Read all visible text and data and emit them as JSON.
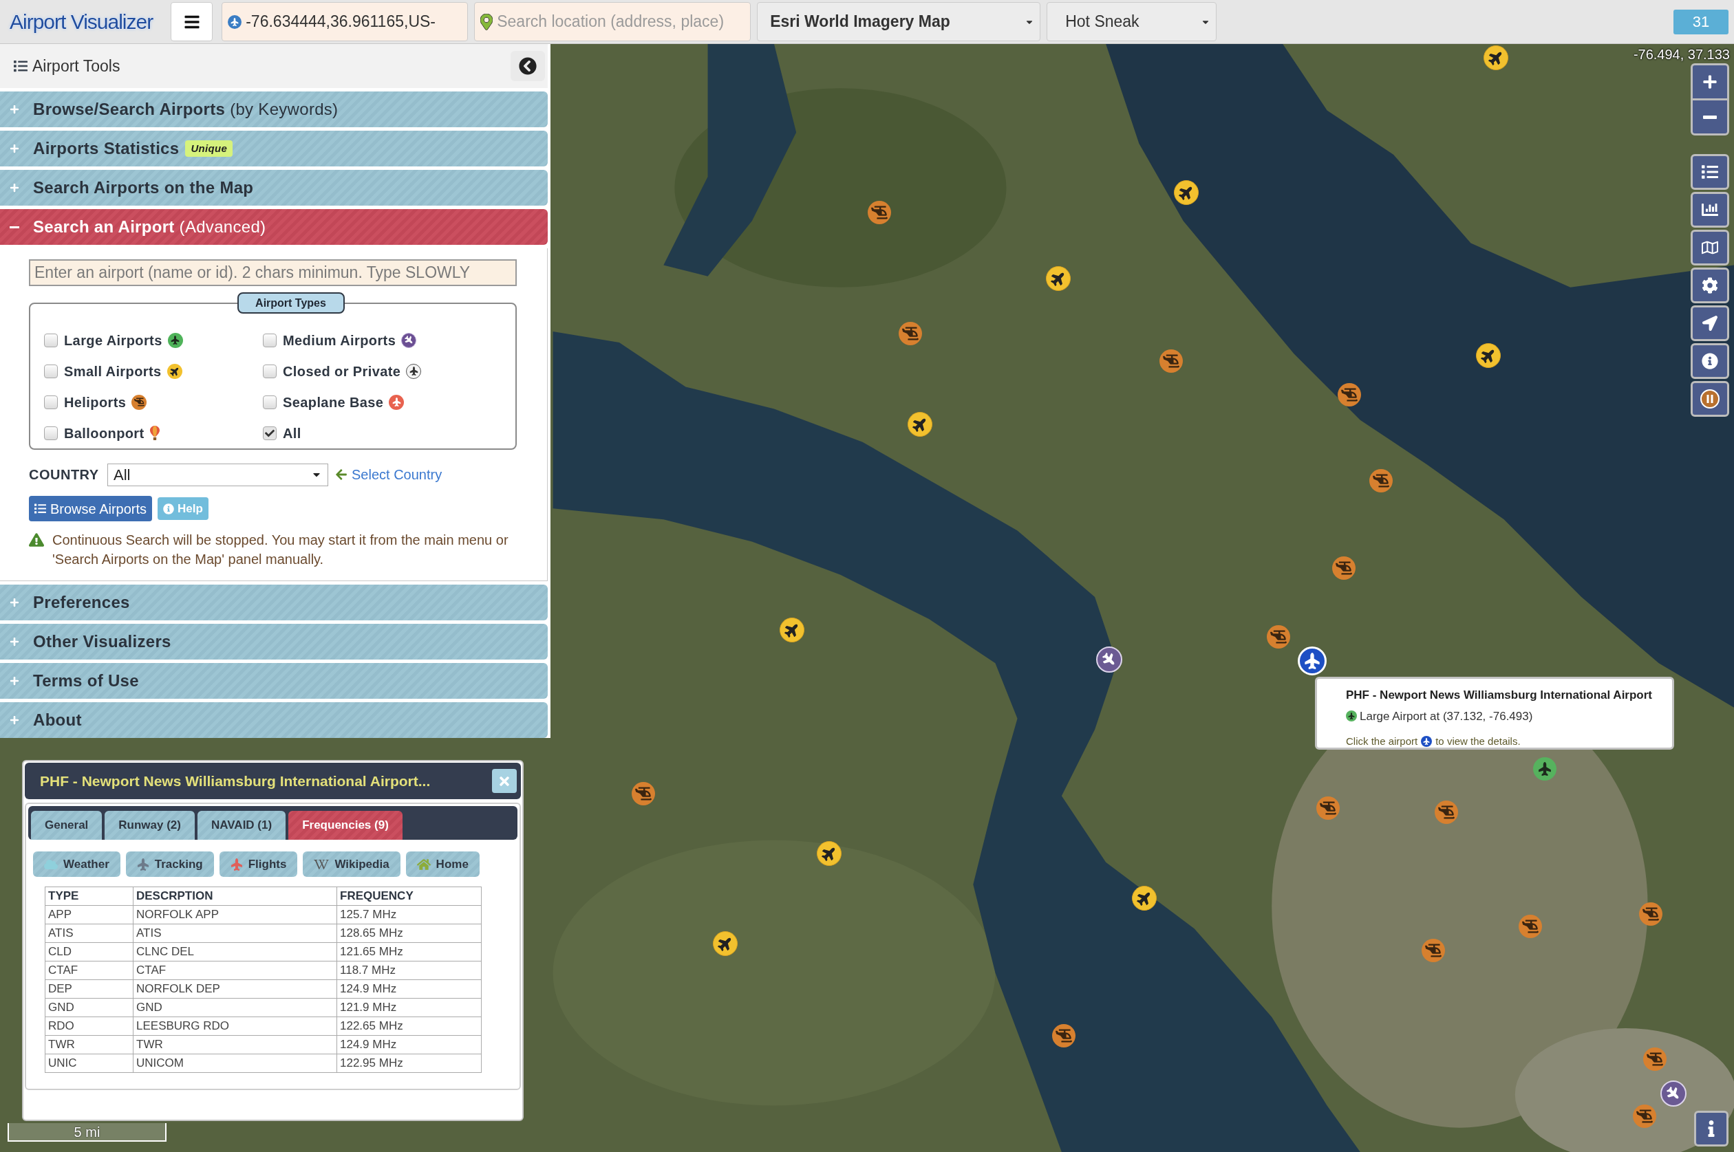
{
  "app_bar": {
    "logo": "Airport Visualizer",
    "coordinates_field": {
      "value": "-76.634444,36.961165,US-"
    },
    "location_search": {
      "placeholder": "Search location (address, place)"
    },
    "basemap_select": {
      "value": "Esri World Imagery Map"
    },
    "theme_select": {
      "value": "Hot Sneak"
    },
    "count_badge": "31"
  },
  "sidebar": {
    "title": "Airport Tools",
    "sections": [
      {
        "title": "Browse/Search Airports",
        "note": "(by Keywords)",
        "expanded": false
      },
      {
        "title": "Airports Statistics",
        "badge": "Unique",
        "expanded": false
      },
      {
        "title": "Search Airports on the Map",
        "expanded": false
      },
      {
        "title": "Search an Airport",
        "note": "(Advanced)",
        "expanded": true
      },
      {
        "title": "Preferences",
        "expanded": false
      },
      {
        "title": "Other Visualizers",
        "expanded": false
      },
      {
        "title": "Terms of Use",
        "expanded": false
      },
      {
        "title": "About",
        "expanded": false
      }
    ]
  },
  "search_panel": {
    "airport_field": {
      "placeholder": "Enter an airport (name or id). 2 chars minimun. Type SLOWLY"
    },
    "types_legend": "Airport Types",
    "airport_types": [
      {
        "label": "Large Airports",
        "kind": "large",
        "checked": false
      },
      {
        "label": "Medium Airports",
        "kind": "medium",
        "checked": false
      },
      {
        "label": "Small Airports",
        "kind": "small",
        "checked": false
      },
      {
        "label": "Closed or Private",
        "kind": "closed",
        "checked": false
      },
      {
        "label": "Heliports",
        "kind": "heliport",
        "checked": false
      },
      {
        "label": "Seaplane Base",
        "kind": "seaplane",
        "checked": false
      },
      {
        "label": "Balloonport",
        "kind": "balloon",
        "checked": false
      },
      {
        "label": "All",
        "kind": "all",
        "checked": true
      }
    ],
    "country": {
      "label": "COUNTRY",
      "value": "All",
      "link": "Select Country"
    },
    "buttons": [
      {
        "label": "Browse Airports",
        "kind": "browse"
      },
      {
        "label": "Help",
        "kind": "help"
      }
    ],
    "warning": "Continuous Search will be stopped. You may start it from the main menu or 'Search Airports on the Map' panel manually."
  },
  "map": {
    "coordinates": "-76.494, 37.133",
    "scale": "5 mi",
    "tooltip": {
      "title": "PHF - Newport News Williamsburg International Airport",
      "detail": "Large Airport at (37.132, -76.493)",
      "hint_start": "Click the airport",
      "hint_end": "to view the details."
    }
  },
  "airport_popup": {
    "title": "PHF - Newport News Williamsburg International Airport...",
    "tabs": [
      {
        "label": "General",
        "selected": false
      },
      {
        "label": "Runway (2)",
        "selected": false
      },
      {
        "label": "NAVAID (1)",
        "selected": false
      },
      {
        "label": "Frequencies (9)",
        "selected": true
      }
    ],
    "links": [
      {
        "label": "Weather",
        "kind": "weather"
      },
      {
        "label": "Tracking",
        "kind": "tracking"
      },
      {
        "label": "Flights",
        "kind": "flights"
      },
      {
        "label": "Wikipedia",
        "kind": "wikipedia"
      },
      {
        "label": "Home",
        "kind": "home"
      }
    ],
    "table": {
      "columns": [
        "TYPE",
        "DESCRPTION",
        "FREQUENCY"
      ],
      "rows": [
        [
          "APP",
          "NORFOLK APP",
          "125.7 MHz"
        ],
        [
          "ATIS",
          "ATIS",
          "128.65 MHz"
        ],
        [
          "CLD",
          "CLNC DEL",
          "121.65 MHz"
        ],
        [
          "CTAF",
          "CTAF",
          "118.7 MHz"
        ],
        [
          "DEP",
          "NORFOLK DEP",
          "124.9 MHz"
        ],
        [
          "GND",
          "GND",
          "121.9 MHz"
        ],
        [
          "RDO",
          "LEESBURG RDO",
          "122.65 MHz"
        ],
        [
          "TWR",
          "TWR",
          "124.9 MHz"
        ],
        [
          "UNIC",
          "UNICOM",
          "122.95 MHz"
        ]
      ]
    }
  }
}
